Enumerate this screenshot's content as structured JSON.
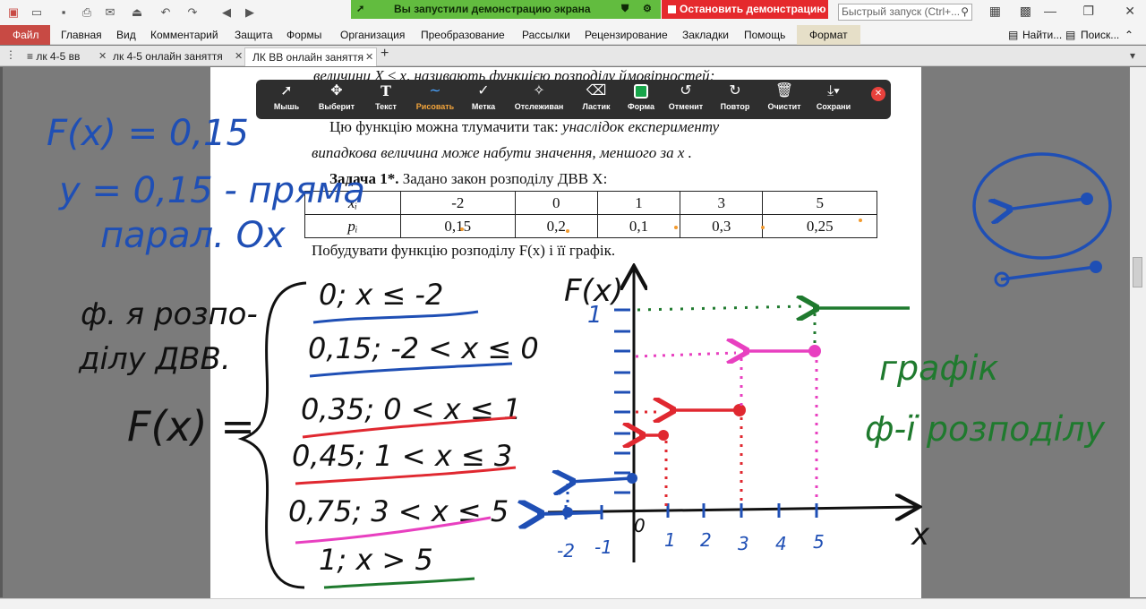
{
  "share_bar": {
    "status": "Вы запустили демонстрацию экрана",
    "stop_label": "Остановить демонстрацию"
  },
  "search": {
    "placeholder": "Быстрый запуск (Ctrl+..."
  },
  "menu": {
    "file": "Файл",
    "items": [
      "Главная",
      "Вид",
      "Комментарий",
      "Защита",
      "Формы",
      "Организация",
      "Преобразование",
      "Рассылки",
      "Рецензирование",
      "Закладки",
      "Помощь",
      "Формат"
    ],
    "find": "Найти...",
    "search": "Поиск..."
  },
  "tabs": [
    {
      "label": "лк 4-5 вв"
    },
    {
      "label": "лк 4-5 онлайн заняття"
    },
    {
      "label": "ЛК ВВ онлайн заняття"
    }
  ],
  "annot_toolbar": {
    "tools": [
      {
        "label": "Мышь",
        "icon": "cursor-icon"
      },
      {
        "label": "Выберит",
        "icon": "move-icon"
      },
      {
        "label": "Текст",
        "icon": "text-icon"
      },
      {
        "label": "Рисовать",
        "icon": "draw-icon"
      },
      {
        "label": "Метка",
        "icon": "check-icon"
      },
      {
        "label": "Отслеживан",
        "icon": "spotlight-icon"
      },
      {
        "label": "Ластик",
        "icon": "eraser-icon"
      },
      {
        "label": "Форма",
        "icon": "shape-icon"
      },
      {
        "label": "Отменит",
        "icon": "undo-icon"
      },
      {
        "label": "Повтор",
        "icon": "redo-icon"
      },
      {
        "label": "Очистит",
        "icon": "trash-icon"
      },
      {
        "label": "Сохрани",
        "icon": "save-icon"
      }
    ],
    "active": "Рисовать"
  },
  "document": {
    "top_line": "величини X ≤ x, називають функцією розподілу ймовірностей;",
    "interp_prefix": "Цю функцію можна тлумачити так:",
    "interp_italic": "унаслідок експерименту",
    "interp_line2": "випадкова величина може набути значення, меншого за x .",
    "task_bold": "Задача 1*.",
    "task_text": " Задано закон розподілу ДВВ X:",
    "table": {
      "row_labels": [
        "xᵢ",
        "pᵢ"
      ],
      "x": [
        "-2",
        "0",
        "1",
        "3",
        "5"
      ],
      "p": [
        "0,15",
        "0,2",
        "0,1",
        "0,3",
        "0,25"
      ]
    },
    "build": "Побудувати функцію розподілу F(x) і її графік."
  },
  "handwriting": {
    "blue_note1": "F(x) = 0,15",
    "blue_note2": "y = 0,15 - пряма",
    "blue_note3": "парал. Ox",
    "black_label1": "ф. я розпо-",
    "black_label2": "ділу ДВВ.",
    "black_fx": "F(x) =",
    "cases": [
      "0; x ≤ -2",
      "0,15; -2 < x ≤ 0",
      "0,35; 0 < x ≤ 1",
      "0,45; 1 < x ≤ 3",
      "0,75; 3 < x ≤ 5",
      "1; x > 5"
    ],
    "graph_ylabel": "F(x)",
    "graph_xlabel": "x",
    "graph_one": "1",
    "x_ticks": [
      "-2",
      "-1",
      "0",
      "1",
      "2",
      "3",
      "4",
      "5"
    ],
    "green_note1": "графік",
    "green_note2": "ф-ї розподілу"
  },
  "colors": {
    "blue": "#1f4fb5",
    "red": "#e02830",
    "magenta": "#e840c0",
    "green": "#1f7a2e",
    "black": "#111111"
  }
}
